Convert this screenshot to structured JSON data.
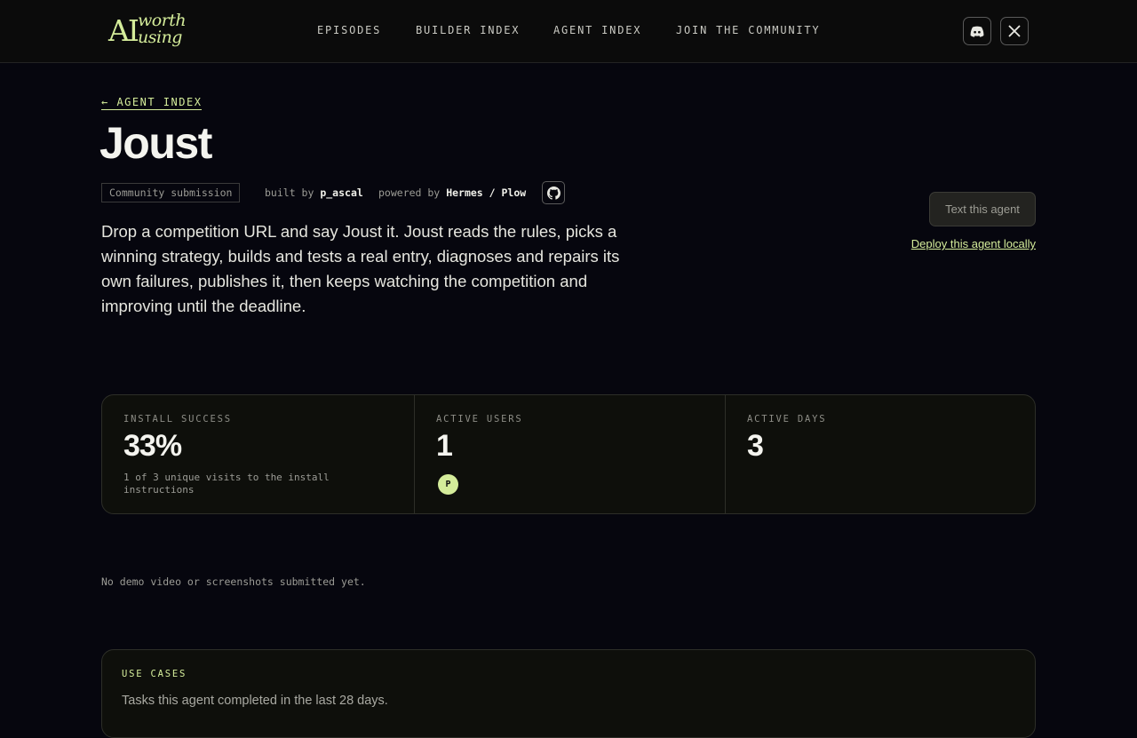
{
  "header": {
    "logo": {
      "ai": "AI",
      "line1": "worth",
      "line2": "using"
    },
    "nav": [
      "EPISODES",
      "BUILDER INDEX",
      "AGENT INDEX",
      "JOIN THE COMMUNITY"
    ],
    "icons": [
      "discord-icon",
      "x-icon"
    ]
  },
  "agent": {
    "back_link": "← AGENT INDEX",
    "name": "Joust",
    "tag": "Community submission",
    "built_by_label": "built by",
    "built_by": "p_ascal",
    "powered_by_label": "powered by",
    "powered_by": "Hermes / Plow",
    "description": "Drop a competition URL and say Joust it. Joust reads the rules, picks a winning strategy, builds and tests a real entry, diagnoses and repairs its own failures, publishes it, then keeps watching the competition and improving until the deadline.",
    "text_button": "Text this agent",
    "deploy_link": "Deploy this agent locally"
  },
  "stats": [
    {
      "label": "INSTALL SUCCESS",
      "value": "33%",
      "sub": "1 of 3 unique visits to the install instructions"
    },
    {
      "label": "ACTIVE USERS",
      "value": "1",
      "avatars": [
        "P"
      ]
    },
    {
      "label": "ACTIVE DAYS",
      "value": "3"
    }
  ],
  "media_note": "No demo video or screenshots submitted yet.",
  "use_cases": {
    "heading": "USE CASES",
    "subtitle": "Tasks this agent completed in the last 28 days."
  },
  "colors": {
    "accent": "#d4ec9a",
    "background": "#06060e",
    "header": "#0b0b0b",
    "card": "#0e0f0b"
  }
}
